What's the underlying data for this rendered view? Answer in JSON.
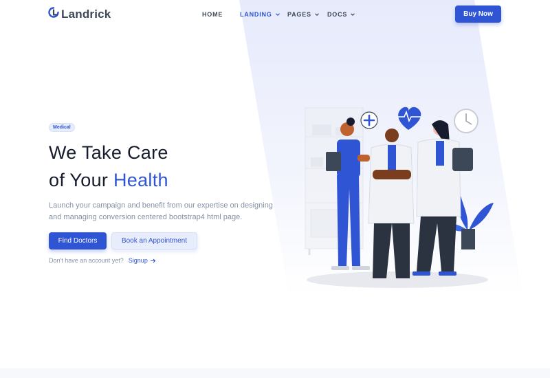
{
  "brand": {
    "name": "Landrick",
    "logo_icon": "landrick-logo-icon",
    "accent": "#2f55d4"
  },
  "nav": {
    "items": [
      {
        "label": "HOME",
        "active": false,
        "dropdown": false
      },
      {
        "label": "LANDING",
        "active": true,
        "dropdown": true
      },
      {
        "label": "PAGES",
        "active": false,
        "dropdown": true
      },
      {
        "label": "DOCS",
        "active": false,
        "dropdown": true
      }
    ],
    "cta": "Buy Now"
  },
  "hero": {
    "badge": "Medical",
    "title_line1": "We Take Care",
    "title_line2_prefix": "of Your ",
    "title_line2_accent": "Health",
    "description": "Launch your campaign and benefit from our expertise on designing and managing conversion centered bootstrap4 html page.",
    "primary_button": "Find Doctors",
    "secondary_button": "Book an Appointment",
    "signup_prompt": "Don't have an account yet?",
    "signup_link": "Signup"
  },
  "icons": {
    "signup_arrow": "arrow-right-icon",
    "nav_chevron": "chevron-down-icon"
  }
}
